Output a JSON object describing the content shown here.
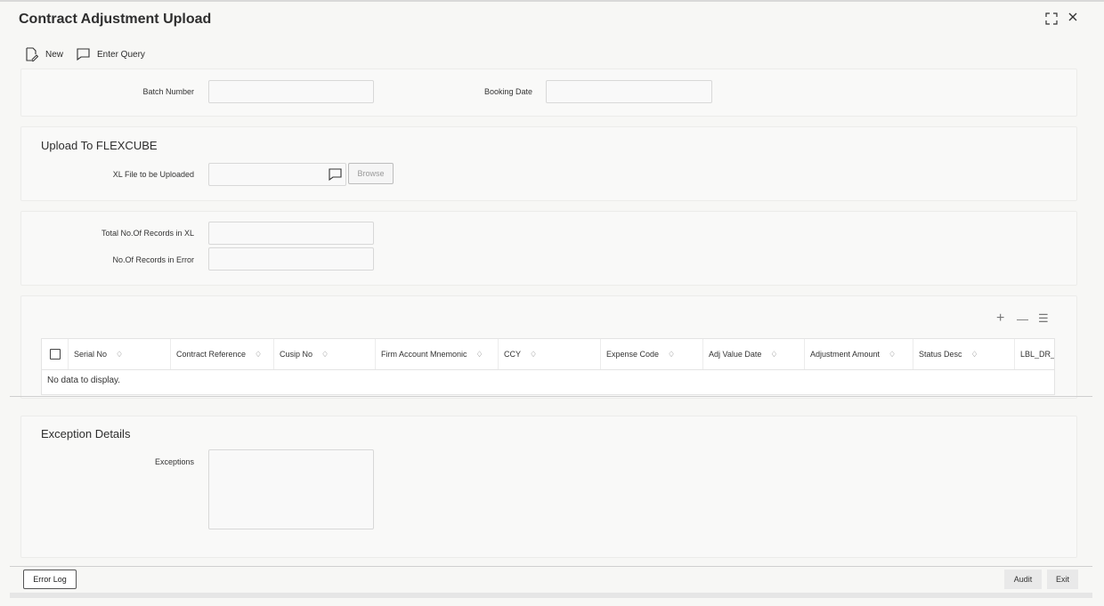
{
  "window": {
    "title": "Contract Adjustment Upload",
    "maximize_icon": "maximize-icon",
    "close_icon": "close-icon"
  },
  "toolbar": {
    "new_label": "New",
    "enter_query_label": "Enter Query"
  },
  "header": {
    "batch_number_label": "Batch Number",
    "batch_number_value": "",
    "booking_date_label": "Booking Date",
    "booking_date_value": ""
  },
  "upload": {
    "section_title": "Upload To FLEXCUBE",
    "file_label": "XL File to be Uploaded",
    "file_value": "",
    "browse_label": "Browse"
  },
  "records": {
    "total_label": "Total No.Of Records in XL",
    "total_value": "",
    "error_label": "No.Of Records in Error",
    "error_value": ""
  },
  "grid": {
    "columns": [
      "Serial No",
      "Contract Reference",
      "Cusip No",
      "Firm Account Mnemonic",
      "CCY",
      "Expense Code",
      "Adj Value Date",
      "Adjustment Amount",
      "Status Desc",
      "LBL_DR_A"
    ],
    "sort_glyph": "♢",
    "empty_text": "No data to display.",
    "add_glyph": "+",
    "remove_glyph": "—",
    "columns_glyph": "☰"
  },
  "exceptions": {
    "section_title": "Exception Details",
    "label": "Exceptions",
    "value": ""
  },
  "footer": {
    "error_log_label": "Error Log",
    "audit_label": "Audit",
    "exit_label": "Exit"
  }
}
